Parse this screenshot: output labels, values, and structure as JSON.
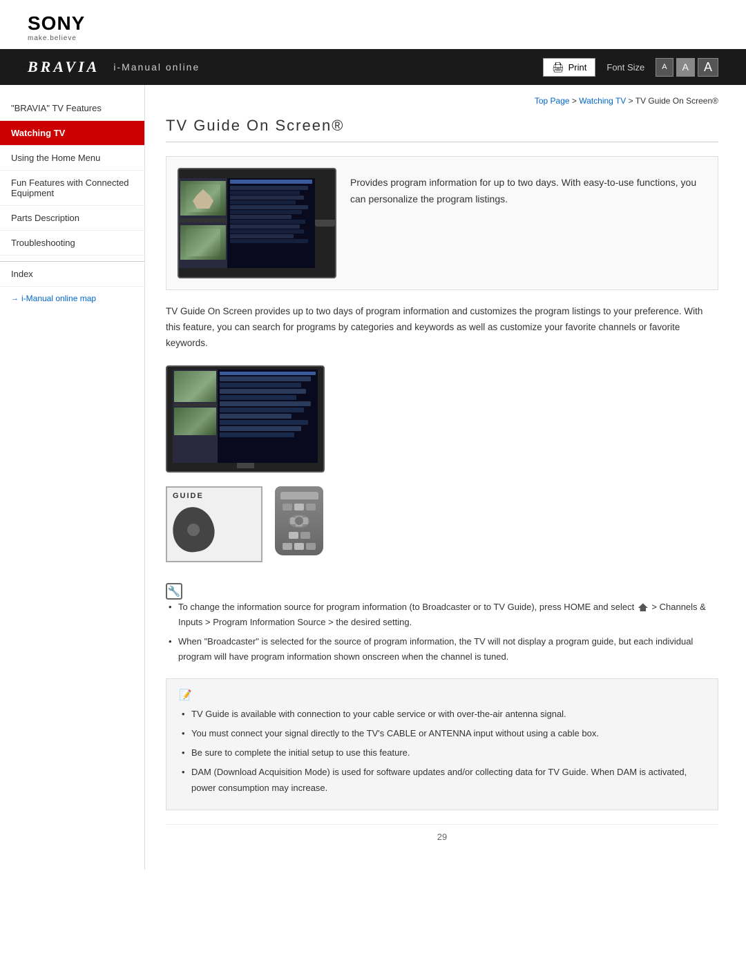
{
  "header": {
    "sony_logo": "SONY",
    "sony_tagline": "make.believe",
    "bravia_logo": "BRAVIA",
    "bravia_subtitle": "i-Manual online",
    "print_label": "Print",
    "font_size_label": "Font Size",
    "font_sizes": [
      "A",
      "A",
      "A"
    ]
  },
  "breadcrumb": {
    "top_page": "Top Page",
    "separator1": " > ",
    "watching_tv": "Watching TV",
    "separator2": " > ",
    "current": "TV Guide On Screen®"
  },
  "sidebar": {
    "items": [
      {
        "id": "bravia-features",
        "label": "\"BRAVIA\" TV Features",
        "active": false
      },
      {
        "id": "watching-tv",
        "label": "Watching TV",
        "active": true
      },
      {
        "id": "using-home-menu",
        "label": "Using the Home Menu",
        "active": false
      },
      {
        "id": "fun-features",
        "label": "Fun Features with Connected Equipment",
        "active": false
      },
      {
        "id": "parts-description",
        "label": "Parts Description",
        "active": false
      },
      {
        "id": "troubleshooting",
        "label": "Troubleshooting",
        "active": false
      },
      {
        "id": "index",
        "label": "Index",
        "active": false
      }
    ],
    "map_link": "i-Manual online map"
  },
  "content": {
    "page_title": "TV Guide On Screen®",
    "intro_text": "Provides program information for up to two days. With easy-to-use functions, you can personalize the program listings.",
    "body_text": "TV Guide On Screen provides up to two days of program information and customizes the program listings to your preference. With this feature, you can search for programs by categories and keywords as well as customize your favorite channels or favorite keywords.",
    "guide_label": "GUIDE",
    "tip_items": [
      "To change the information source for program information (to Broadcaster or to TV Guide), press HOME and select  > Channels & Inputs > Program Information Source > the desired setting.",
      "When \"Broadcaster\" is selected for the source of program information, the TV will not display a program guide, but each individual program will have program information shown onscreen when the channel is tuned."
    ],
    "note_items": [
      "TV Guide is available with connection to your cable service or with over-the-air antenna signal.",
      "You must connect your signal directly to the TV's CABLE or ANTENNA input without using a cable box.",
      "Be sure to complete the initial setup to use this feature.",
      "DAM (Download Acquisition Mode) is used for software updates and/or collecting data for TV Guide. When DAM is activated, power consumption may increase."
    ],
    "page_number": "29"
  }
}
